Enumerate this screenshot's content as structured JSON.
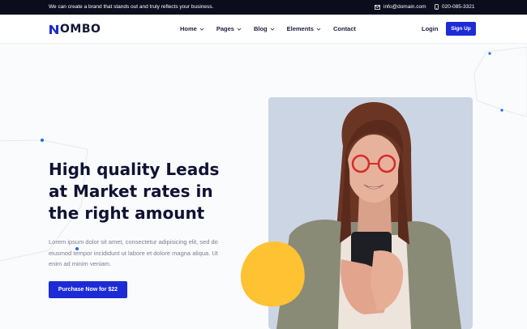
{
  "topbar": {
    "tagline": "We can create a brand that stands out and truly reflects your business.",
    "email": "info@domain.com",
    "phone": "020-085-3321"
  },
  "header": {
    "logo": "OMBO",
    "nav": [
      {
        "label": "Home",
        "has_dropdown": true
      },
      {
        "label": "Pages",
        "has_dropdown": true
      },
      {
        "label": "Blog",
        "has_dropdown": true
      },
      {
        "label": "Elements",
        "has_dropdown": true
      },
      {
        "label": "Contact",
        "has_dropdown": false
      }
    ],
    "login": "Login",
    "signup": "Sign Up"
  },
  "hero": {
    "title": "High quality Leads at Market rates in the right amount",
    "text": "Lorem ipsum dolor sit amet, consectetur adipisicing elit, sed do eiusmod tempor incididunt ut labore et dolore magna aliqua. Ut enim ad minim veniam.",
    "cta": "Purchase Now for $22"
  },
  "colors": {
    "accent": "#1d2bd6",
    "dark": "#0b0d1c",
    "blob": "#ffc233",
    "photo_bg": "#ccd5e3"
  }
}
